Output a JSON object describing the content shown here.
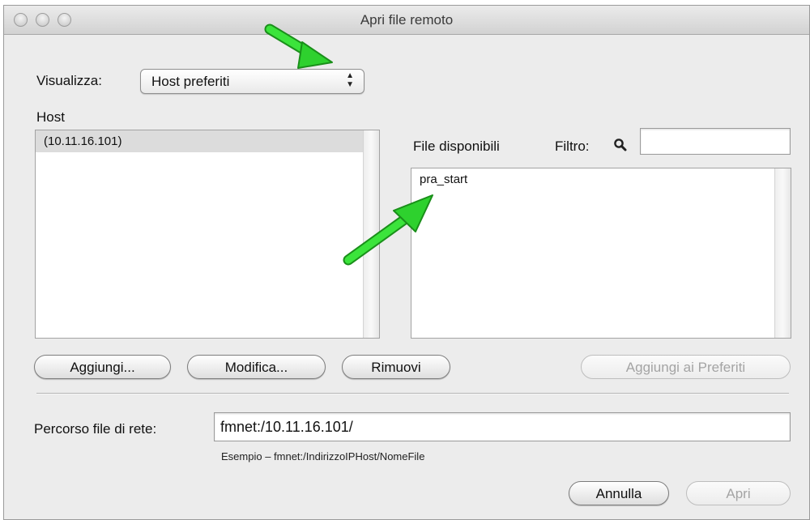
{
  "window": {
    "title": "Apri file remoto"
  },
  "view": {
    "label": "Visualizza:",
    "selected": "Host preferiti"
  },
  "hosts": {
    "label": "Host",
    "items": [
      "(10.11.16.101)"
    ]
  },
  "files": {
    "label": "File disponibili",
    "items": [
      "pra_start"
    ]
  },
  "filter": {
    "label": "Filtro:",
    "value": ""
  },
  "host_buttons": {
    "add": "Aggiungi...",
    "edit": "Modifica...",
    "remove": "Rimuovi",
    "add_favorites": "Aggiungi ai Preferiti"
  },
  "path": {
    "label": "Percorso file di rete:",
    "value": "fmnet:/10.11.16.101/",
    "example": "Esempio – fmnet:/IndirizzoIPHost/NomeFile"
  },
  "actions": {
    "cancel": "Annulla",
    "open": "Apri"
  },
  "colors": {
    "annotation_arrow": "#2ed12e"
  }
}
